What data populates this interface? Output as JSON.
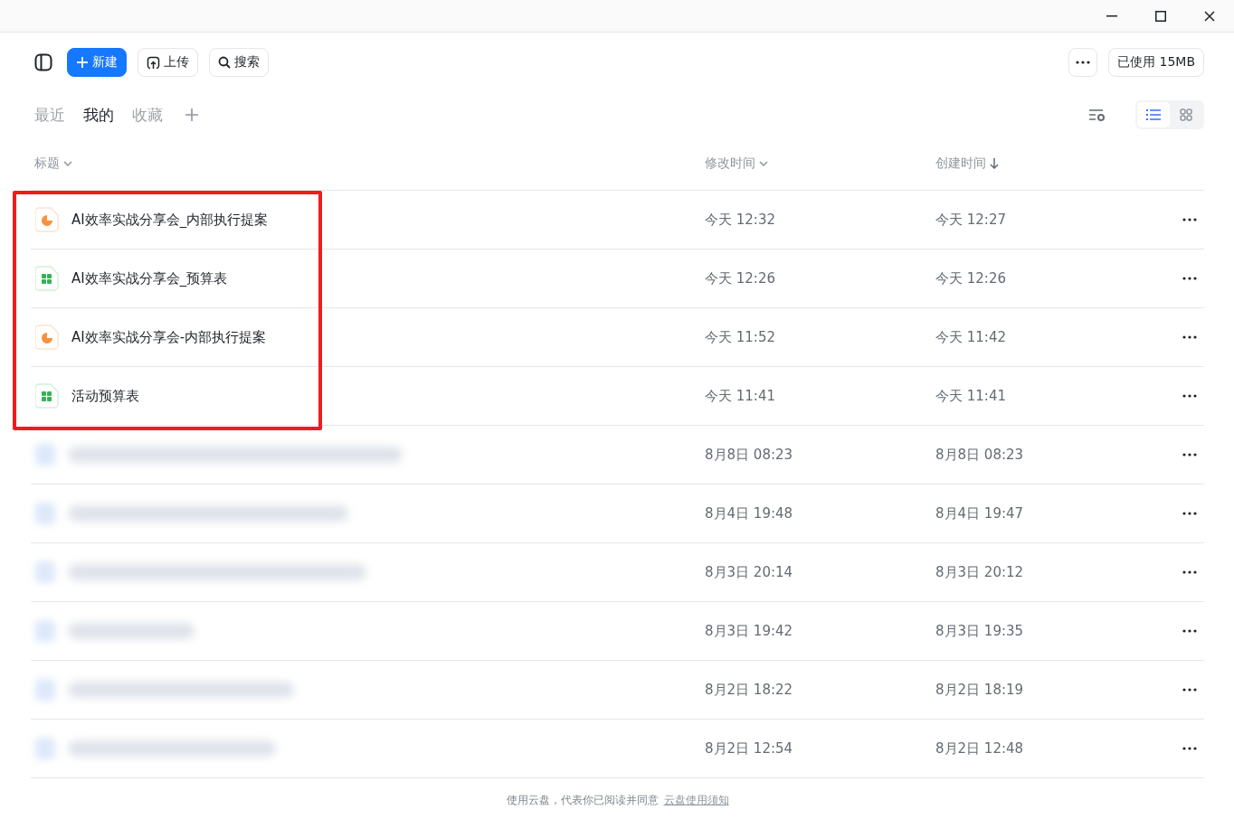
{
  "toolbar": {
    "new_button": "新建",
    "upload_button": "上传",
    "search_button": "搜索",
    "usage": "已使用 15MB"
  },
  "tabs": [
    {
      "label": "最近",
      "selected": false
    },
    {
      "label": "我的",
      "selected": true
    },
    {
      "label": "收藏",
      "selected": false
    }
  ],
  "view_mode": {
    "list_selected": true
  },
  "table": {
    "columns": [
      "标题",
      "修改时间",
      "创建时间"
    ],
    "rows": [
      {
        "kind": "presentation",
        "title": "AI效率实战分享会_内部执行提案",
        "modified": "今天 12:32",
        "created": "今天 12:27",
        "highlighted": true
      },
      {
        "kind": "spreadsheet",
        "title": "AI效率实战分享会_预算表",
        "modified": "今天 12:26",
        "created": "今天 12:26",
        "highlighted": true
      },
      {
        "kind": "presentation",
        "title": "AI效率实战分享会-内部执行提案",
        "modified": "今天 11:52",
        "created": "今天 11:42",
        "highlighted": true
      },
      {
        "kind": "spreadsheet",
        "title": "活动预算表",
        "modified": "今天 11:41",
        "created": "今天 11:41",
        "highlighted": true
      },
      {
        "kind": "blurred",
        "modified": "8月8日 08:23",
        "created": "8月8日 08:23",
        "highlighted": false
      },
      {
        "kind": "blurred",
        "modified": "8月4日 19:48",
        "created": "8月4日 19:47",
        "highlighted": false
      },
      {
        "kind": "blurred",
        "modified": "8月3日 20:14",
        "created": "8月3日 20:12",
        "highlighted": false
      },
      {
        "kind": "blurred",
        "modified": "8月3日 19:42",
        "created": "8月3日 19:35",
        "highlighted": false
      },
      {
        "kind": "blurred",
        "modified": "8月2日 18:22",
        "created": "8月2日 18:19",
        "highlighted": false
      },
      {
        "kind": "blurred",
        "modified": "8月2日 12:54",
        "created": "8月2日 12:48",
        "highlighted": false
      }
    ]
  },
  "footer": {
    "text": "使用云盘，代表你已阅读并同意",
    "link": "云盘使用须知"
  }
}
